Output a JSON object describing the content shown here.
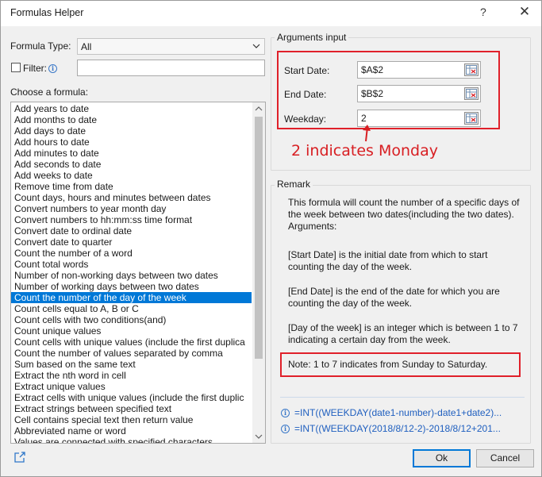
{
  "window": {
    "title": "Formulas Helper",
    "help_glyph": "?",
    "close_glyph": "✕"
  },
  "left": {
    "formula_type_label": "Formula Type:",
    "formula_type_value": "All",
    "filter_label": "Filter:",
    "filter_value": "",
    "choose_label": "Choose a formula:",
    "selected_index": 17,
    "formulas": [
      "Add years to date",
      "Add months to date",
      "Add days to date",
      "Add hours to date",
      "Add minutes to date",
      "Add seconds to date",
      "Add weeks to date",
      "Remove time from date",
      "Count days, hours and minutes between dates",
      "Convert numbers to year month day",
      "Convert numbers to hh:mm:ss time format",
      "Convert date to ordinal date",
      "Convert date to quarter",
      "Count the number of a word",
      "Count total words",
      "Number of non-working days between two dates",
      "Number of working days between two dates",
      "Count the number of the day of the week",
      "Count cells equal to A, B or C",
      "Count cells with two conditions(and)",
      "Count unique values",
      "Count cells with unique values (include the first duplica",
      "Count the number of values separated by comma",
      "Sum based on the same text",
      "Extract the nth word in cell",
      "Extract unique values",
      "Extract cells with unique values (include the first duplic",
      "Extract strings between specified text",
      "Cell contains special text then return value",
      "Abbreviated name or word",
      "Values are connected with specified characters"
    ]
  },
  "arguments": {
    "group_title": "Arguments input",
    "start_label": "Start Date:",
    "start_value": "$A$2",
    "end_label": "End Date:",
    "end_value": "$B$2",
    "weekday_label": "Weekday:",
    "weekday_value": "2",
    "annotation": "2 indicates Monday"
  },
  "remark": {
    "group_title": "Remark",
    "p1": "This formula will count the number of a specific days of the week between two dates(including the two dates). Arguments:",
    "p2": "[Start Date] is the initial date from which to start counting the day of the week.",
    "p3": "[End Date] is the end of the date for which you are counting the day of the week.",
    "p4": "[Day of the week] is an integer which is between 1 to 7 indicating a certain day from the week.",
    "note": "Note: 1 to 7 indicates from Sunday to Saturday.",
    "formula1": "=INT((WEEKDAY(date1-number)-date1+date2)...",
    "formula2": "=INT((WEEKDAY(2018/8/12-2)-2018/8/12+201..."
  },
  "buttons": {
    "ok": "Ok",
    "cancel": "Cancel"
  },
  "colors": {
    "selection": "#0078d7",
    "highlight_red": "#e0202a",
    "formula_blue": "#1f5fbf"
  }
}
